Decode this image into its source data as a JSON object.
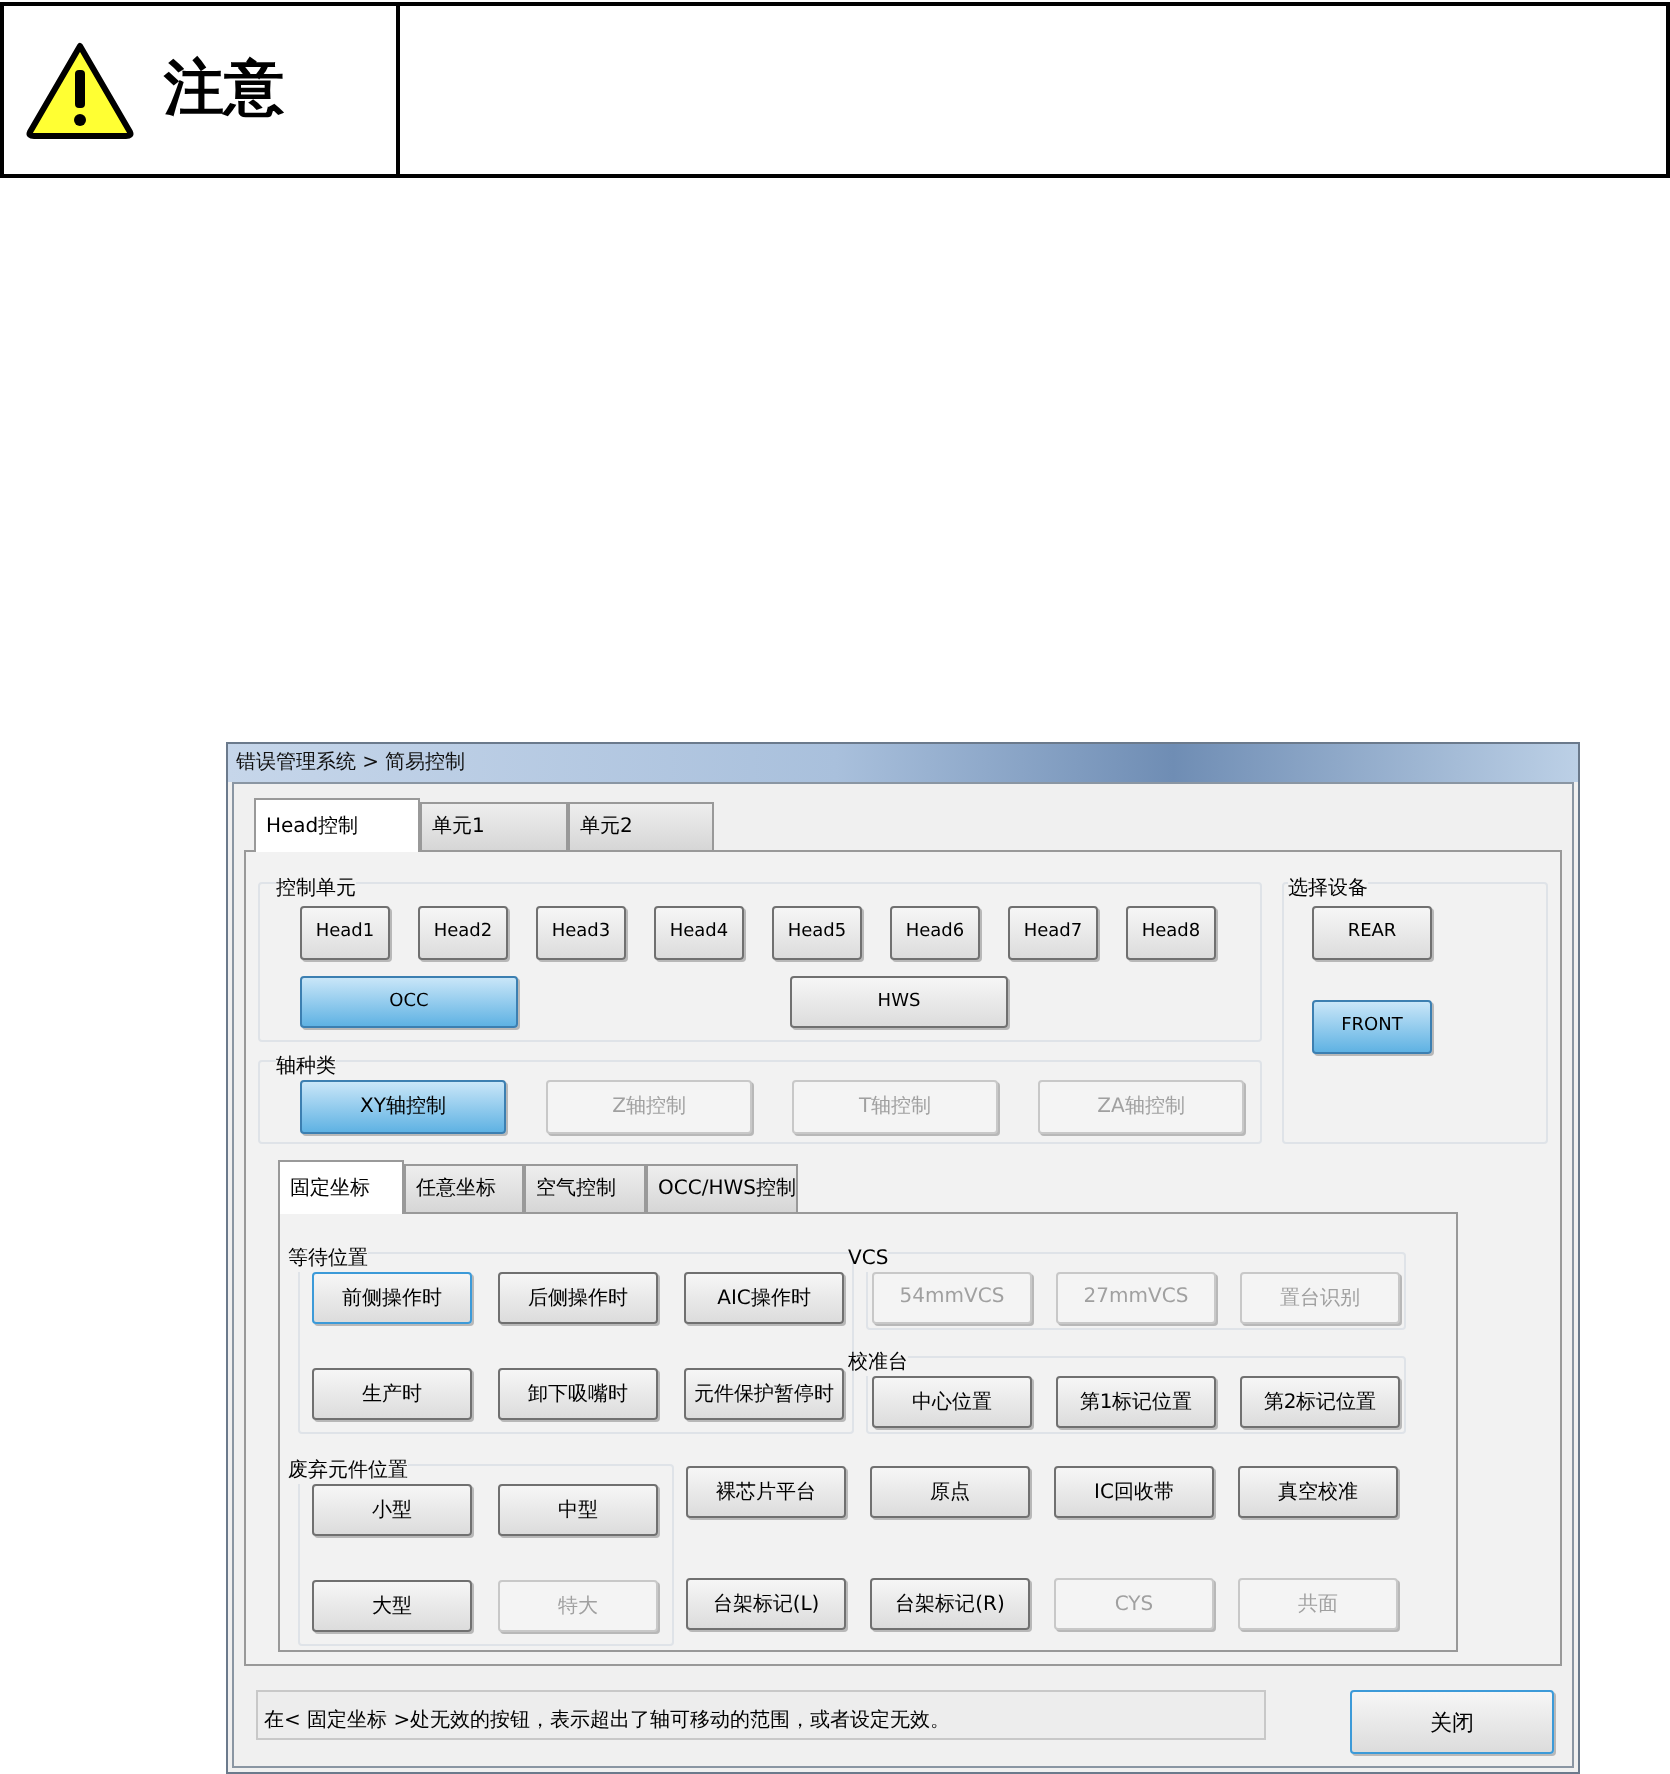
{
  "notice": {
    "label": "注意"
  },
  "window": {
    "title": "错误管理系统 > 简易控制"
  },
  "tabs": [
    {
      "label": "Head控制",
      "selected": true
    },
    {
      "label": "单元1",
      "selected": false
    },
    {
      "label": "单元2",
      "selected": false
    }
  ],
  "control_unit": {
    "title": "控制单元",
    "heads": [
      {
        "label": "Head1",
        "selected": false
      },
      {
        "label": "Head2",
        "selected": false
      },
      {
        "label": "Head3",
        "selected": false
      },
      {
        "label": "Head4",
        "selected": false
      },
      {
        "label": "Head5",
        "selected": false
      },
      {
        "label": "Head6",
        "selected": false
      },
      {
        "label": "Head7",
        "selected": false
      },
      {
        "label": "Head8",
        "selected": false
      }
    ],
    "units": [
      {
        "label": "OCC",
        "selected": true
      },
      {
        "label": "HWS",
        "selected": false
      }
    ]
  },
  "device": {
    "title": "选择设备",
    "buttons": [
      {
        "label": "REAR",
        "selected": false
      },
      {
        "label": "FRONT",
        "selected": true
      }
    ]
  },
  "axis": {
    "title": "轴种类",
    "buttons": [
      {
        "label": "XY轴控制",
        "selected": true,
        "disabled": false
      },
      {
        "label": "Z轴控制",
        "selected": false,
        "disabled": true
      },
      {
        "label": "T轴控制",
        "selected": false,
        "disabled": true
      },
      {
        "label": "ZA轴控制",
        "selected": false,
        "disabled": true
      }
    ]
  },
  "subtabs": [
    {
      "label": "固定坐标",
      "selected": true
    },
    {
      "label": "任意坐标",
      "selected": false
    },
    {
      "label": "空气控制",
      "selected": false
    },
    {
      "label": "OCC/HWS控制",
      "selected": false
    }
  ],
  "wait_position": {
    "title": "等待位置",
    "buttons": [
      {
        "label": "前侧操作时",
        "focused": true
      },
      {
        "label": "后侧操作时",
        "focused": false
      },
      {
        "label": "AIC操作时",
        "focused": false
      },
      {
        "label": "生产时",
        "focused": false
      },
      {
        "label": "卸下吸嘴时",
        "focused": false
      },
      {
        "label": "元件保护暂停时",
        "focused": false
      }
    ]
  },
  "vcs": {
    "title": "VCS",
    "buttons": [
      {
        "label": "54mmVCS",
        "disabled": true
      },
      {
        "label": "27mmVCS",
        "disabled": true
      },
      {
        "label": "置台识别",
        "disabled": true
      }
    ]
  },
  "calibration": {
    "title": "校准台",
    "buttons": [
      {
        "label": "中心位置"
      },
      {
        "label": "第1标记位置"
      },
      {
        "label": "第2标记位置"
      }
    ]
  },
  "discard": {
    "title": "废弃元件位置",
    "buttons": [
      {
        "label": "小型",
        "disabled": false
      },
      {
        "label": "中型",
        "disabled": false
      },
      {
        "label": "大型",
        "disabled": false
      },
      {
        "label": "特大",
        "disabled": true
      }
    ]
  },
  "other_buttons": [
    {
      "label": "裸芯片平台",
      "disabled": false
    },
    {
      "label": "原点",
      "disabled": false
    },
    {
      "label": "IC回收带",
      "disabled": false
    },
    {
      "label": "真空校准",
      "disabled": false
    },
    {
      "label": "台架标记(L)",
      "disabled": false
    },
    {
      "label": "台架标记(R)",
      "disabled": false
    },
    {
      "label": "CYS",
      "disabled": true
    },
    {
      "label": "共面",
      "disabled": true
    }
  ],
  "status_text": "在< 固定坐标 >处无效的按钮，表示超出了轴可移动的范围，或者设定无效。",
  "close_button": {
    "label": "关闭",
    "focused": true
  }
}
